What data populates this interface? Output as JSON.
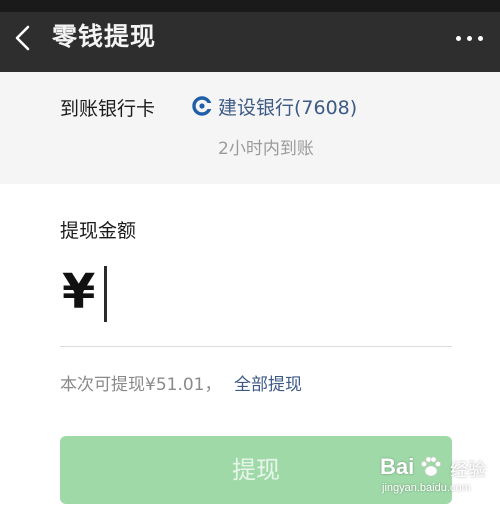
{
  "header": {
    "title": "零钱提现"
  },
  "bank": {
    "label": "到账银行卡",
    "name": "建设银行(7608)",
    "arrival_time": "2小时内到账",
    "icon": "ccb-bank-icon"
  },
  "amount": {
    "label": "提现金额",
    "currency_symbol": "¥",
    "value": "",
    "available_text": "本次可提现¥51.01，",
    "withdraw_all_label": "全部提现"
  },
  "submit": {
    "label": "提现",
    "enabled": false
  },
  "watermark": {
    "brand": "Bai",
    "brand_suffix": "经验",
    "url": "jingyan.baidu.com"
  },
  "colors": {
    "topbar": "#2e2e2e",
    "link": "#3d5a86",
    "button_disabled": "#9fd9a8"
  }
}
